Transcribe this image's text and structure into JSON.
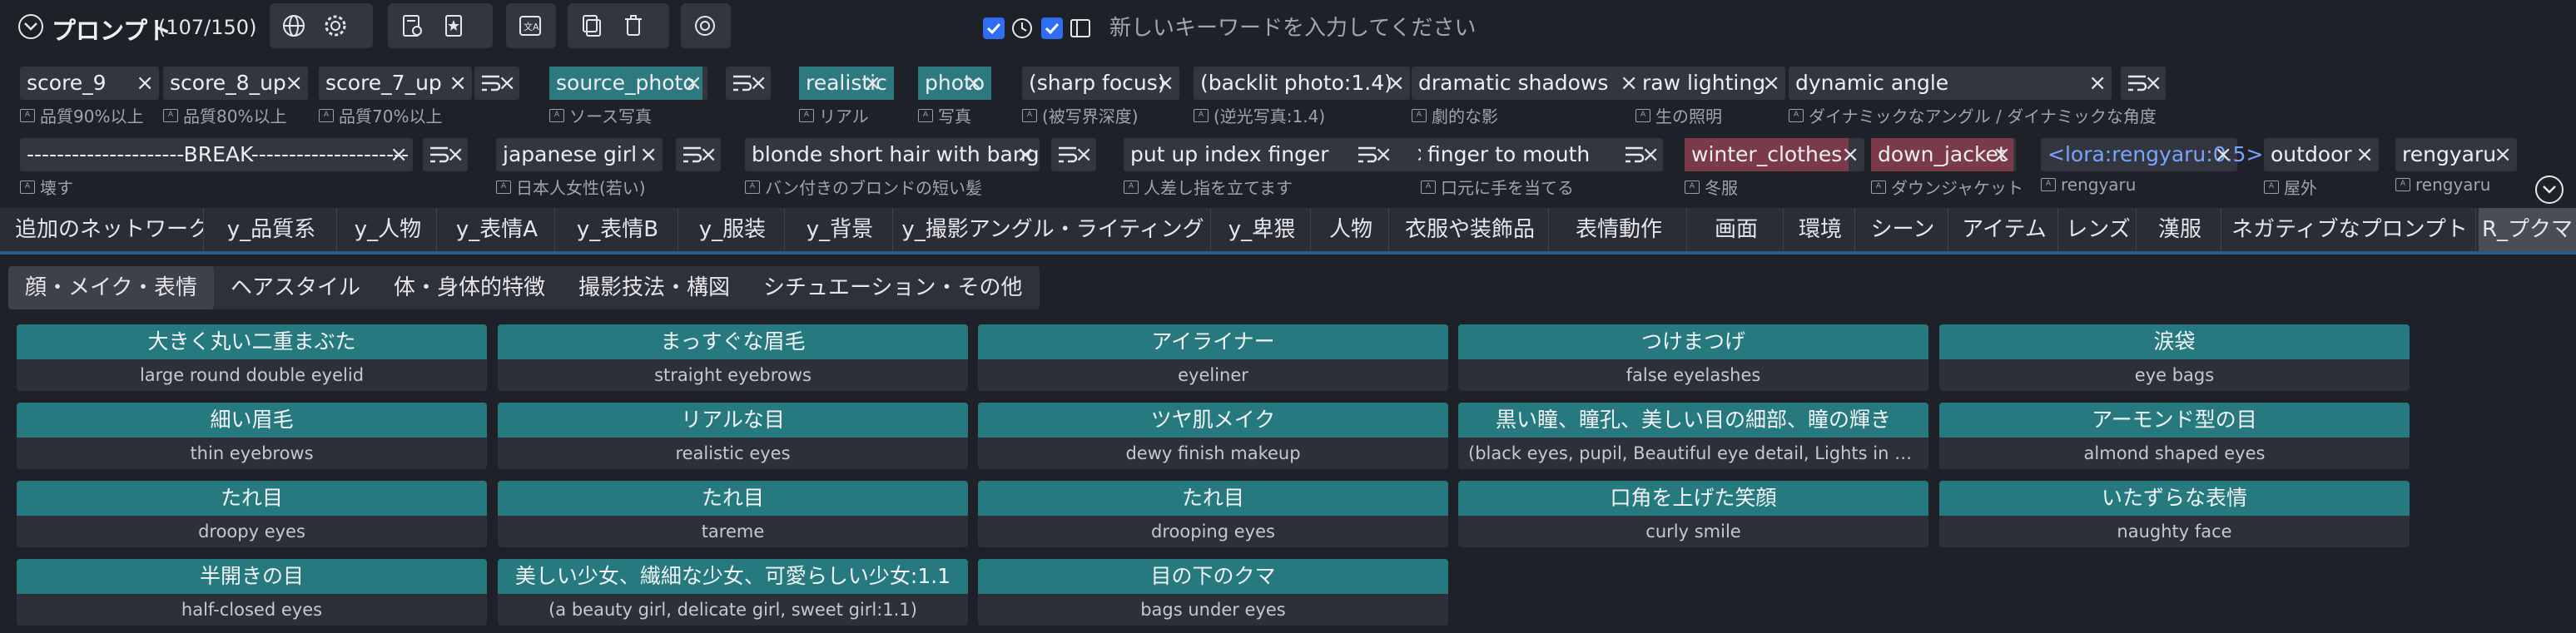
{
  "header": {
    "title": "プロンプト",
    "count": "(107/150)",
    "keyword_placeholder": "新しいキーワードを入力してください",
    "keyword_value": ""
  },
  "tags_row1": [
    {
      "text": "score_9",
      "sub": "品質90%以上",
      "style": "plain"
    },
    {
      "text": "score_8_up",
      "sub": "品質80%以上",
      "style": "plain"
    },
    {
      "text": "score_7_up",
      "sub": "品質70%以上",
      "style": "plain"
    },
    {
      "text": "",
      "sub": "",
      "style": "break"
    },
    {
      "text": "source_photo",
      "sub": "ソース写真",
      "style": "teal"
    },
    {
      "text": "",
      "sub": "",
      "style": "break"
    },
    {
      "text": "realistic",
      "sub": "リアル",
      "style": "teal"
    },
    {
      "text": "photo",
      "sub": "写真",
      "style": "teal"
    },
    {
      "text": "(sharp focus)",
      "sub": "(被写界深度)",
      "style": "plain"
    },
    {
      "text": "(backlit photo:1.4)",
      "sub": "(逆光写真:1.4)",
      "style": "plain"
    },
    {
      "text": "dramatic shadows",
      "sub": "劇的な影",
      "style": "plain"
    },
    {
      "text": "raw lighting",
      "sub": "生の照明",
      "style": "plain"
    },
    {
      "text": "dynamic angle",
      "sub": "ダイナミックなアングル / ダイナミックな角度",
      "style": "plain"
    },
    {
      "text": "",
      "sub": "",
      "style": "break"
    }
  ],
  "tags_row2": [
    {
      "text": "---------------------BREAK---------------------",
      "sub": "壊す",
      "style": "plain"
    },
    {
      "text": "",
      "sub": "",
      "style": "break"
    },
    {
      "text": "japanese girl",
      "sub": "日本人女性(若い)",
      "style": "plain"
    },
    {
      "text": "",
      "sub": "",
      "style": "break"
    },
    {
      "text": "blonde short hair with bang",
      "sub": "バン付きのブロンドの短い髪",
      "style": "plain"
    },
    {
      "text": "",
      "sub": "",
      "style": "break"
    },
    {
      "text": "put up index finger",
      "sub": "人差し指を立てます",
      "style": "plain"
    },
    {
      "text": "",
      "sub": "",
      "style": "break"
    },
    {
      "text": "finger to mouth",
      "sub": "口元に手を当てる",
      "style": "plain"
    },
    {
      "text": "",
      "sub": "",
      "style": "break"
    },
    {
      "text": "winter_clothes",
      "sub": "冬服",
      "style": "maroon"
    },
    {
      "text": "down_jacket",
      "sub": "ダウンジャケット",
      "style": "maroon"
    },
    {
      "text": "<lora:rengyaru:0.5>",
      "sub": "rengyaru",
      "style": "lora"
    },
    {
      "text": "outdoor",
      "sub": "屋外",
      "style": "plain"
    },
    {
      "text": "rengyaru",
      "sub": "rengyaru",
      "style": "plain"
    }
  ],
  "tabs": [
    "追加のネットワーク",
    "y_品質系",
    "y_人物",
    "y_表情A",
    "y_表情B",
    "y_服装",
    "y_背景",
    "y_撮影アングル・ライティング",
    "y_卑猥",
    "人物",
    "衣服や装飾品",
    "表情動作",
    "画面",
    "環境",
    "シーン",
    "アイテム",
    "レンズ",
    "漢服",
    "ネガティブなプロンプト",
    "R_プクマ"
  ],
  "subtabs": [
    "顔・メイク・表情",
    "ヘアスタイル",
    "体・身体的特徴",
    "撮影技法・構図",
    "シチュエーション・その他"
  ],
  "cards": [
    {
      "jp": "大きく丸い二重まぶた",
      "en": "large round double eyelid"
    },
    {
      "jp": "まっすぐな眉毛",
      "en": "straight eyebrows"
    },
    {
      "jp": "アイライナー",
      "en": "eyeliner"
    },
    {
      "jp": "つけまつげ",
      "en": "false eyelashes"
    },
    {
      "jp": "涙袋",
      "en": "eye bags"
    },
    {
      "jp": "細い眉毛",
      "en": "thin eyebrows"
    },
    {
      "jp": "リアルな目",
      "en": "realistic eyes"
    },
    {
      "jp": "ツヤ肌メイク",
      "en": "dewy finish makeup"
    },
    {
      "jp": "黒い瞳、瞳孔、美しい目の細部、瞳の輝き",
      "en": "(black eyes, pupil, Beautiful eye detail, Lights in the e..."
    },
    {
      "jp": "アーモンド型の目",
      "en": "almond shaped eyes"
    },
    {
      "jp": "たれ目",
      "en": "droopy eyes"
    },
    {
      "jp": "たれ目",
      "en": "tareme"
    },
    {
      "jp": "たれ目",
      "en": "drooping eyes"
    },
    {
      "jp": "口角を上げた笑顔",
      "en": "curly smile"
    },
    {
      "jp": "いたずらな表情",
      "en": "naughty face"
    },
    {
      "jp": "半開きの目",
      "en": "half-closed eyes"
    },
    {
      "jp": "美しい少女、繊細な少女、可愛らしい少女:1.1",
      "en": "(a beauty girl, delicate girl, sweet girl:1.1)"
    },
    {
      "jp": "目の下のクマ",
      "en": "bags under eyes"
    }
  ]
}
